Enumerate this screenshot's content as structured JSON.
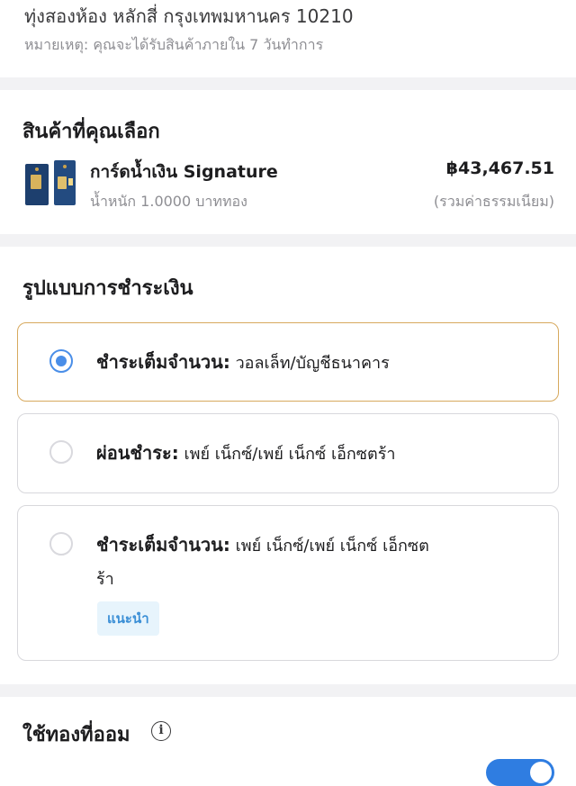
{
  "address": {
    "line": "ทุ่งสองห้อง หลักสี่ กรุงเทพมหานคร 10210",
    "note": "หมายเหตุ: คุณจะได้รับสินค้าภายใน 7 วันทำการ"
  },
  "selected_product": {
    "title": "สินค้าที่คุณเลือก",
    "thumbnail": "gold-card-product-image",
    "name": "การ์ดน้ำเงิน Signature",
    "weight": "น้ำหนัก 1.0000 บาททอง",
    "price": "฿43,467.51",
    "fee_note": "(รวมค่าธรรมเนียม)"
  },
  "payment": {
    "title": "รูปแบบการชำระเงิน",
    "options": [
      {
        "label": "ชำระเต็มจำนวน:",
        "detail": "วอลเล็ท/บัญชีธนาคาร",
        "selected": true
      },
      {
        "label": "ผ่อนชำระ:",
        "detail": "เพย์ เน็กซ์/เพย์ เน็กซ์ เอ็กซตร้า",
        "selected": false
      },
      {
        "label": "ชำระเต็มจำนวน:",
        "detail_line1": "เพย์ เน็กซ์/เพย์ เน็กซ์ เอ็กซต",
        "detail_line2": "ร้า",
        "badge": "แนะนำ",
        "selected": false
      }
    ]
  },
  "savings": {
    "title": "ใช้ทองที่ออม",
    "info_icon": "info-icon",
    "toggle_on": true
  },
  "colors": {
    "accent_blue": "#4a8ee8",
    "selected_border": "#d7a95e",
    "badge_bg": "#e7f4fc",
    "badge_text": "#3b8fd6",
    "toggle": "#2f7de1"
  }
}
